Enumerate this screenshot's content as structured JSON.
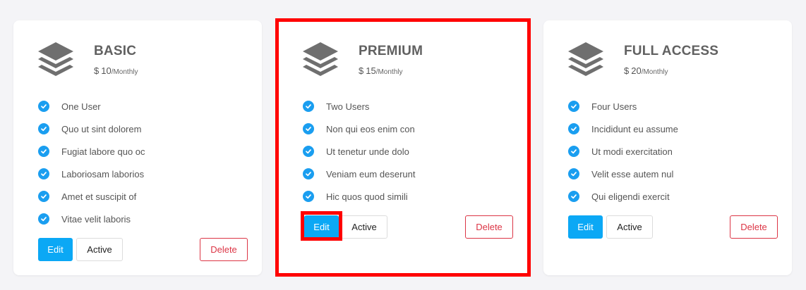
{
  "plans": [
    {
      "title": "BASIC",
      "currency": "$",
      "amount": "10",
      "period": "/Monthly",
      "features": [
        "One User",
        "Quo ut sint dolorem",
        "Fugiat labore quo oc",
        "Laboriosam laborios",
        "Amet et suscipit of",
        "Vitae velit laboris"
      ],
      "edit_label": "Edit",
      "active_label": "Active",
      "delete_label": "Delete"
    },
    {
      "title": "PREMIUM",
      "currency": "$",
      "amount": "15",
      "period": "/Monthly",
      "features": [
        "Two Users",
        "Non qui eos enim con",
        "Ut tenetur unde dolo",
        "Veniam eum deserunt",
        "Hic quos quod simili"
      ],
      "edit_label": "Edit",
      "active_label": "Active",
      "delete_label": "Delete"
    },
    {
      "title": "FULL ACCESS",
      "currency": "$",
      "amount": "20",
      "period": "/Monthly",
      "features": [
        "Four Users",
        "Incididunt eu assume",
        "Ut modi exercitation",
        "Velit esse autem nul",
        "Qui eligendi exercit"
      ],
      "edit_label": "Edit",
      "active_label": "Active",
      "delete_label": "Delete"
    }
  ],
  "icons": {
    "plan": "layers-icon",
    "feature": "check-circle-icon"
  },
  "colors": {
    "primary": "#0ba8f5",
    "check": "#1a9ef0",
    "danger": "#dc3545",
    "highlight": "#ff0000",
    "title": "#616161",
    "background": "#f4f4f7"
  }
}
